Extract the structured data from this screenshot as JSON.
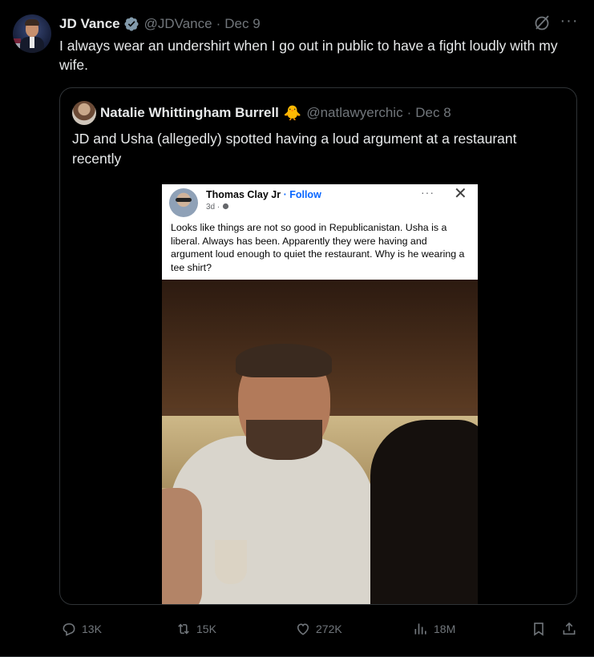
{
  "tweet": {
    "author_name": "JD Vance",
    "handle": "@JDVance",
    "separator": "·",
    "date": "Dec 9",
    "text": "I always wear an undershirt when I go out in public to have a fight loudly with my wife.",
    "more_label": "···"
  },
  "quote": {
    "author_name": "Natalie Whittingham Burrell",
    "emoji": "🐥",
    "handle": "@natlawyerchic",
    "separator": "·",
    "date": "Dec 8",
    "text": "JD and Usha (allegedly) spotted having a loud argument at a restaurant recently"
  },
  "facebook_post": {
    "name": "Thomas Clay Jr",
    "follow": "· Follow",
    "time": "3d ·",
    "more": "···",
    "close": "✕",
    "text": "Looks like things are not so good in Republicanistan. Usha is a liberal. Always has been. Apparently they were having and argument loud enough to quiet the restaurant. Why is he wearing a tee shirt?"
  },
  "actions": {
    "replies": "13K",
    "retweets": "15K",
    "likes": "272K",
    "views": "18M"
  },
  "colors": {
    "background": "#000000",
    "text": "#e7e9ea",
    "muted": "#71767b",
    "border": "#2f3336",
    "verified_badge": "#829aab",
    "facebook_blue": "#0866ff"
  },
  "icons": [
    "verified-badge-icon",
    "grok-icon",
    "more-icon",
    "reply-icon",
    "retweet-icon",
    "like-icon",
    "views-icon",
    "bookmark-icon",
    "share-icon"
  ]
}
